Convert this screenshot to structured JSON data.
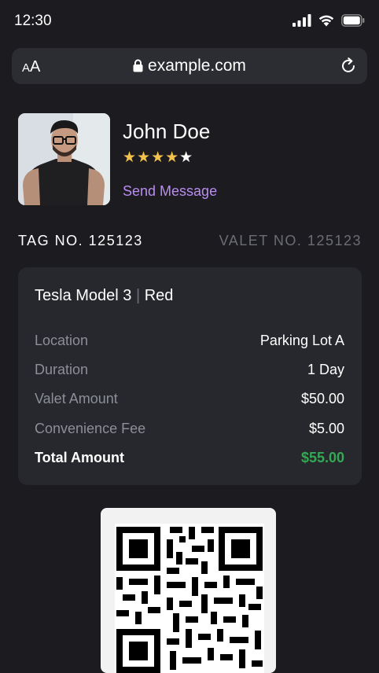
{
  "status_bar": {
    "time": "12:30",
    "icons": [
      "cellular-signal-icon",
      "wifi-icon",
      "battery-icon"
    ]
  },
  "browser": {
    "text_size_label_small": "A",
    "text_size_label_large": "A",
    "url": "example.com",
    "icons": [
      "lock-icon",
      "reload-icon"
    ]
  },
  "profile": {
    "name": "John Doe",
    "rating": 4,
    "rating_max": 5,
    "stars_full": "★★★★",
    "stars_empty": "★",
    "send_message_label": "Send Message"
  },
  "tag_no": "TAG NO. 125123",
  "valet_no": "VALET NO. 125123",
  "vehicle": {
    "model": "Tesla Model 3",
    "separator": "|",
    "color": "Red"
  },
  "details": [
    {
      "label": "Location",
      "value": "Parking Lot A"
    },
    {
      "label": "Duration",
      "value": "1 Day"
    },
    {
      "label": "Valet Amount",
      "value": "$50.00"
    },
    {
      "label": "Convenience Fee",
      "value": "$5.00"
    }
  ],
  "total": {
    "label": "Total Amount",
    "value": "$55.00"
  },
  "colors": {
    "background": "#1c1c20",
    "card": "#27282d",
    "accent_purple": "#b88cf0",
    "star": "#f4c24a",
    "total_green": "#35a853"
  }
}
